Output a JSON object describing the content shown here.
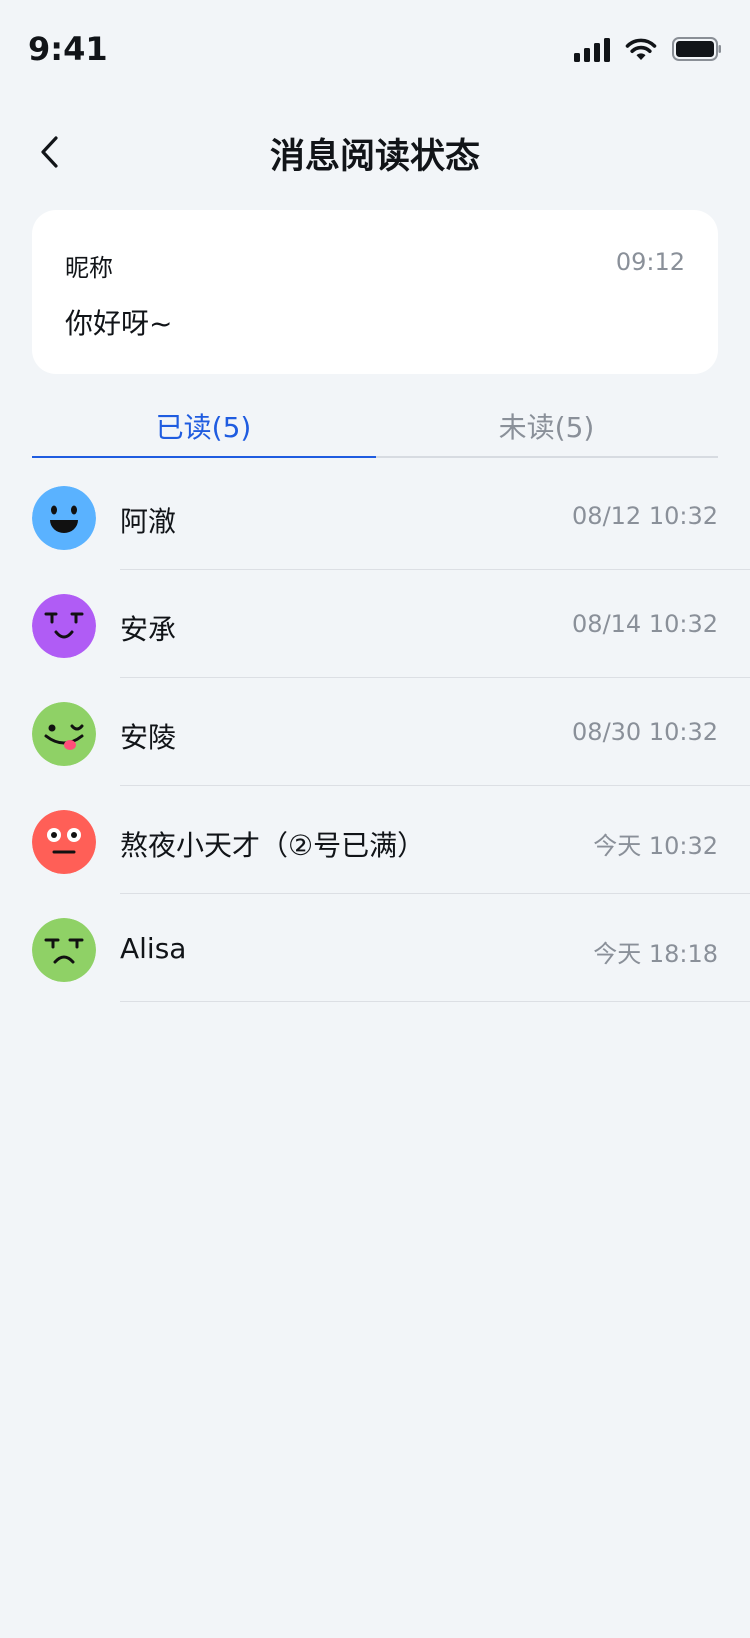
{
  "status_bar": {
    "time": "9:41"
  },
  "nav": {
    "title": "消息阅读状态"
  },
  "message": {
    "sender": "昵称",
    "time": "09:12",
    "text": "你好呀~"
  },
  "tabs": [
    {
      "label": "已读(5)",
      "active": true
    },
    {
      "label": "未读(5)",
      "active": false
    }
  ],
  "colors": {
    "accent": "#1f5ce0",
    "muted": "#8a9099",
    "background": "#f2f5f8"
  },
  "readers": [
    {
      "name": "阿澈",
      "time": "08/12 10:32",
      "avatar_color": "#5ab2ff",
      "avatar_icon": "laughing-face-icon"
    },
    {
      "name": "安承",
      "time": "08/14 10:32",
      "avatar_color": "#b05cf5",
      "avatar_icon": "smirk-face-icon"
    },
    {
      "name": "安陵",
      "time": "08/30 10:32",
      "avatar_color": "#8fd166",
      "avatar_icon": "tongue-wink-face-icon"
    },
    {
      "name": "熬夜小天才（②号已满）",
      "time": "今天 10:32",
      "avatar_color": "#ff5f57",
      "avatar_icon": "surprised-face-icon"
    },
    {
      "name": "Alisa",
      "time": "今天 18:18",
      "avatar_color": "#8fd166",
      "avatar_icon": "annoyed-face-icon"
    }
  ]
}
